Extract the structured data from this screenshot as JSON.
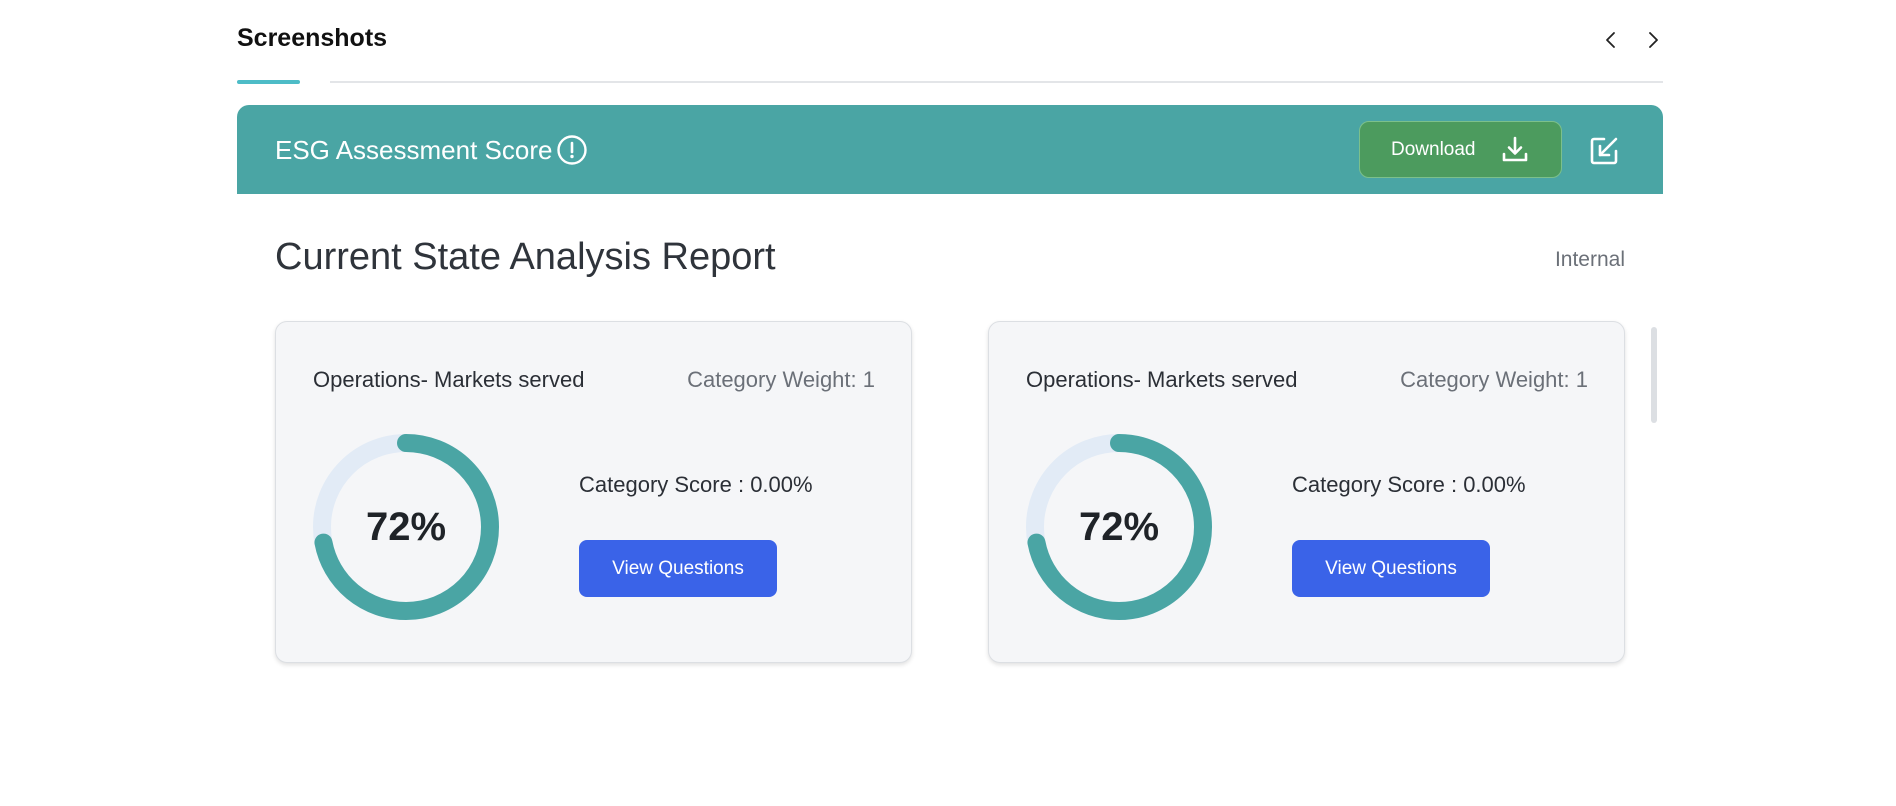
{
  "section": {
    "title": "Screenshots",
    "prev_icon": "chevron-left-icon",
    "next_icon": "chevron-right-icon"
  },
  "banner": {
    "title": "ESG Assessment Score",
    "info_icon": "info-circle-icon",
    "download_label": "Download",
    "download_icon": "download-icon",
    "edit_icon": "external-edit-icon",
    "bg_color": "#4aa5a4",
    "download_color": "#4c9b5e"
  },
  "report": {
    "title": "Current State Analysis Report",
    "tag": "Internal"
  },
  "cards": [
    {
      "category": "Operations- Markets served",
      "weight": "Category Weight: 1",
      "percent_label": "72%",
      "percent": 72,
      "score": "Category Score : 0.00%",
      "button_label": "View Questions"
    },
    {
      "category": "Operations- Markets served",
      "weight": "Category Weight: 1",
      "percent_label": "72%",
      "percent": 72,
      "score": "Category Score : 0.00%",
      "button_label": "View Questions"
    }
  ],
  "colors": {
    "donut_fill": "#4aa5a4",
    "donut_track": "#e2ebf6",
    "button": "#3a63e8",
    "tab_underline": "#4dbcc7"
  }
}
